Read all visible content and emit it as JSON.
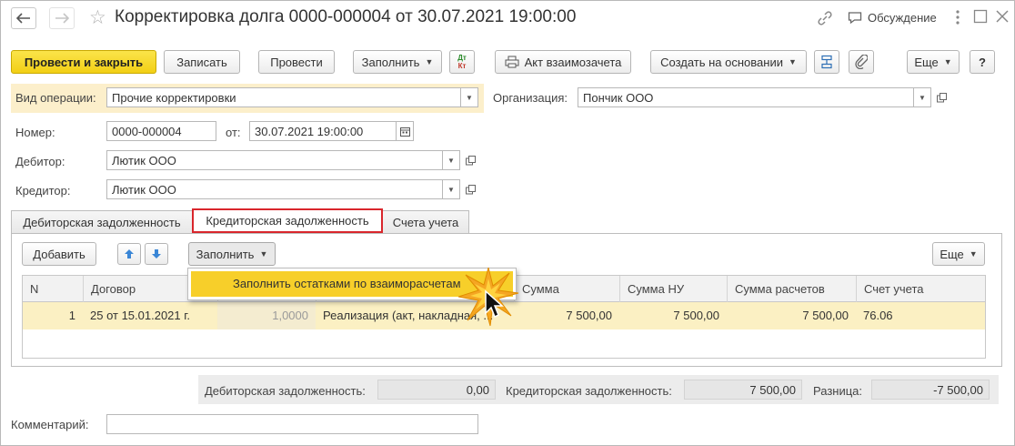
{
  "header": {
    "title": "Корректировка долга 0000-000004 от 30.07.2021 19:00:00",
    "discussion_label": "Обсуждение"
  },
  "toolbar": {
    "post_close": "Провести и закрыть",
    "save": "Записать",
    "post": "Провести",
    "fill": "Заполнить",
    "dt_label": "Дт",
    "kt_label": "Кт",
    "act": "Акт взаимозачета",
    "create_based": "Создать на основании",
    "more": "Еще",
    "help": "?"
  },
  "form": {
    "operation_label": "Вид операции:",
    "operation_value": "Прочие корректировки",
    "organization_label": "Организация:",
    "organization_value": "Пончик ООО",
    "number_label": "Номер:",
    "number_value": "0000-000004",
    "date_label": "от:",
    "date_value": "30.07.2021 19:00:00",
    "debtor_label": "Дебитор:",
    "debtor_value": "Лютик ООО",
    "creditor_label": "Кредитор:",
    "creditor_value": "Лютик ООО"
  },
  "tabs": [
    {
      "label": "Дебиторская задолженность"
    },
    {
      "label": "Кредиторская задолженность"
    },
    {
      "label": "Счета учета"
    }
  ],
  "panel": {
    "add": "Добавить",
    "fill": "Заполнить",
    "more": "Еще",
    "menu_item": "Заполнить остатками по взаиморасчетам"
  },
  "table": {
    "columns": [
      "N",
      "Договор",
      "Сумма",
      "Сумма НУ",
      "Сумма расчетов",
      "Счет учета"
    ],
    "rows": [
      {
        "n": "1",
        "contract": "25 от 15.01.2021 г.",
        "rate": "1,0000",
        "document": "Реализация (акт, накладная, ...",
        "sum": "7 500,00",
        "sum_nu": "7 500,00",
        "sum_settle": "7 500,00",
        "account": "76.06"
      }
    ]
  },
  "totals": {
    "debit_label": "Дебиторская задолженность:",
    "debit_value": "0,00",
    "credit_label": "Кредиторская задолженность:",
    "credit_value": "7 500,00",
    "diff_label": "Разница:",
    "diff_value": "-7 500,00"
  },
  "comment": {
    "label": "Комментарий:",
    "value": ""
  },
  "colors": {
    "primary_button": "#f2cf15",
    "highlight_row": "#fbf0c3",
    "menu_highlight": "#f7cf2a",
    "active_tab_border": "#d9262c"
  }
}
